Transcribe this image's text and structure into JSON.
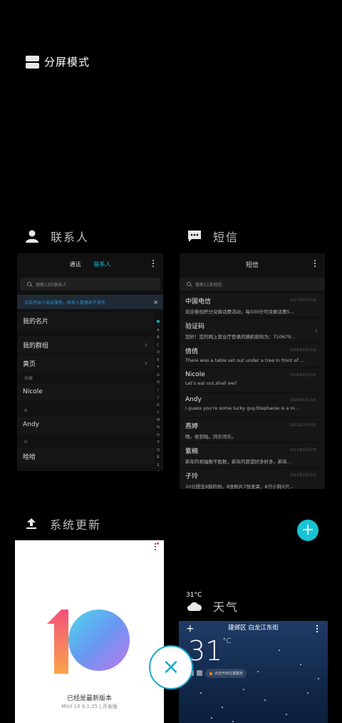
{
  "split_screen": {
    "label": "分屏模式"
  },
  "cards": {
    "contacts": {
      "title": "联系人",
      "tabs": [
        "通话",
        "联系人"
      ],
      "search_placeholder": "搜索13位联系人",
      "notice": "点击开启小米云服务，联系人数据永不丢失",
      "notice_close": "×",
      "rows": [
        {
          "label": "我的名片",
          "chevron": ""
        },
        {
          "label": "我的群组",
          "chevron": "›"
        },
        {
          "label": "黄页",
          "chevron": "›"
        }
      ],
      "section_fav": "收藏",
      "nicole": "Nicole",
      "section_a": "A",
      "andy": "Andy",
      "section_h": "H",
      "haha": "哈哈",
      "alphabet": [
        "♥",
        "A",
        "B",
        "C",
        "D",
        "E",
        "F",
        "G",
        "H",
        "I",
        "J",
        "K",
        "L",
        "M",
        "N",
        "O",
        "P",
        "Q",
        "R",
        "S",
        "#"
      ]
    },
    "sms": {
      "title": "短信",
      "header": "短信",
      "search_placeholder": "搜索11条短信",
      "messages": [
        {
          "name": "中国电信",
          "body": "欢迎参加积分兑换话费活动，每500分可兑换话费5...",
          "date": "2017年6月30日",
          "chevron": ""
        },
        {
          "name": "验证码",
          "body": "您好！您的网上营业厅登录的随机密码为：710679...",
          "date": "",
          "chevron": "›"
        },
        {
          "name": "倩倩",
          "body": "There was a table set out under a tree in front of ...",
          "date": "2018年6月13日",
          "chevron": ""
        },
        {
          "name": "Nicole",
          "body": "Let's eat out,shall we?",
          "date": "2018年6月13日",
          "chevron": ""
        },
        {
          "name": "Andy",
          "body": "I guess you're some lucky guy.Stephanie is a ni...",
          "date": "2018年6月13日",
          "chevron": ""
        },
        {
          "name": "燕婷",
          "body": "嗯。收到啦。同乐同乐。",
          "date": "2013年2月23日",
          "chevron": ""
        },
        {
          "name": "紫楠",
          "body": "新年的祝福数不胜数，新年的愿望好多好多，新年...",
          "date": "2013年2月22日",
          "chevron": ""
        },
        {
          "name": "子玲",
          "body": "10分想念9割的你，8张照片7张发呆，6只小狗5只...",
          "date": "2013年2月22日",
          "chevron": ""
        }
      ]
    },
    "update": {
      "title": "系统更新",
      "status": "已经是最新版本",
      "version": "MIUI 10 9.1.25 | 开发版"
    },
    "weather": {
      "title": "天气",
      "small_temp": "31°C",
      "location": "建邺区 白龙江东街",
      "temperature": "31",
      "unit": "°C",
      "pill_text": "点击开启位置服务",
      "add": "+"
    }
  },
  "fab_label": "+",
  "close_label": "×",
  "colors": {
    "accent": "#17c3d4",
    "close_ring": "#17a9ce"
  }
}
